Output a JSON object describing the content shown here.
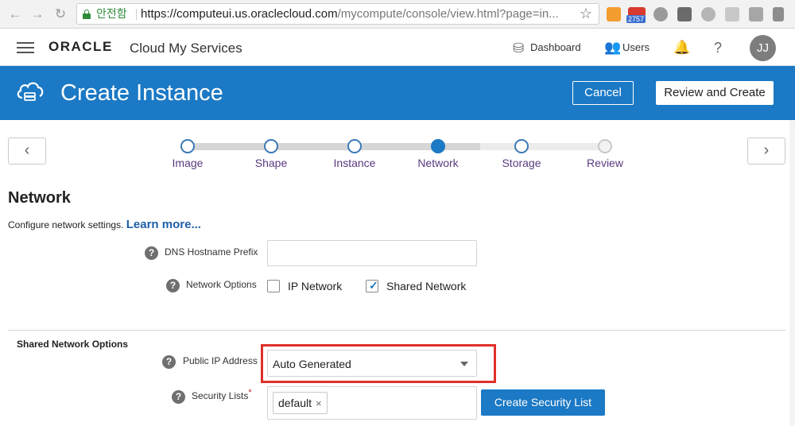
{
  "browser": {
    "secure_label": "안전함",
    "url_host": "https://computeui.us.oraclecloud.com",
    "url_path": "/mycompute/console/view.html?page=in...",
    "badge_count": "2757"
  },
  "header": {
    "logo": "ORACLE",
    "product": "Cloud My Services",
    "dashboard_label": "Dashboard",
    "users_label": "Users",
    "help_label": "?",
    "avatar_initials": "JJ"
  },
  "title_bar": {
    "title": "Create Instance",
    "cancel_label": "Cancel",
    "review_label": "Review and Create"
  },
  "train": {
    "steps": [
      {
        "label": "Image",
        "state": "visited"
      },
      {
        "label": "Shape",
        "state": "visited"
      },
      {
        "label": "Instance",
        "state": "visited"
      },
      {
        "label": "Network",
        "state": "current"
      },
      {
        "label": "Storage",
        "state": "unvisited"
      },
      {
        "label": "Review",
        "state": "disabled"
      }
    ]
  },
  "network": {
    "title": "Network",
    "description": "Configure network settings.",
    "learn_more": "Learn more...",
    "dns_label": "DNS Hostname Prefix",
    "dns_value": "",
    "options_label": "Network Options",
    "ip_network_label": "IP Network",
    "ip_network_checked": false,
    "shared_network_label": "Shared Network",
    "shared_network_checked": true
  },
  "shared": {
    "section_title": "Shared Network Options",
    "public_ip_label": "Public IP Address",
    "public_ip_value": "Auto Generated",
    "security_lists_label": "Security Lists",
    "required_mark": "*",
    "security_tag": "default",
    "remove_icon": "×",
    "create_button": "Create Security List"
  },
  "colors": {
    "brand_blue": "#1b79c5",
    "highlight_red": "#e0302a",
    "step_label": "#5a3a80",
    "link": "#1f5fa8"
  },
  "icons": [
    "back-arrow-icon",
    "forward-arrow-icon",
    "reload-icon",
    "lock-icon",
    "star-icon",
    "rss-icon",
    "hamburger-icon",
    "dashboard-icon",
    "users-icon",
    "bell-icon",
    "cloud-compute-icon",
    "chevron-left-icon",
    "chevron-right-icon",
    "help-icon",
    "checkmark-icon",
    "dropdown-arrow-icon",
    "remove-tag-icon"
  ]
}
